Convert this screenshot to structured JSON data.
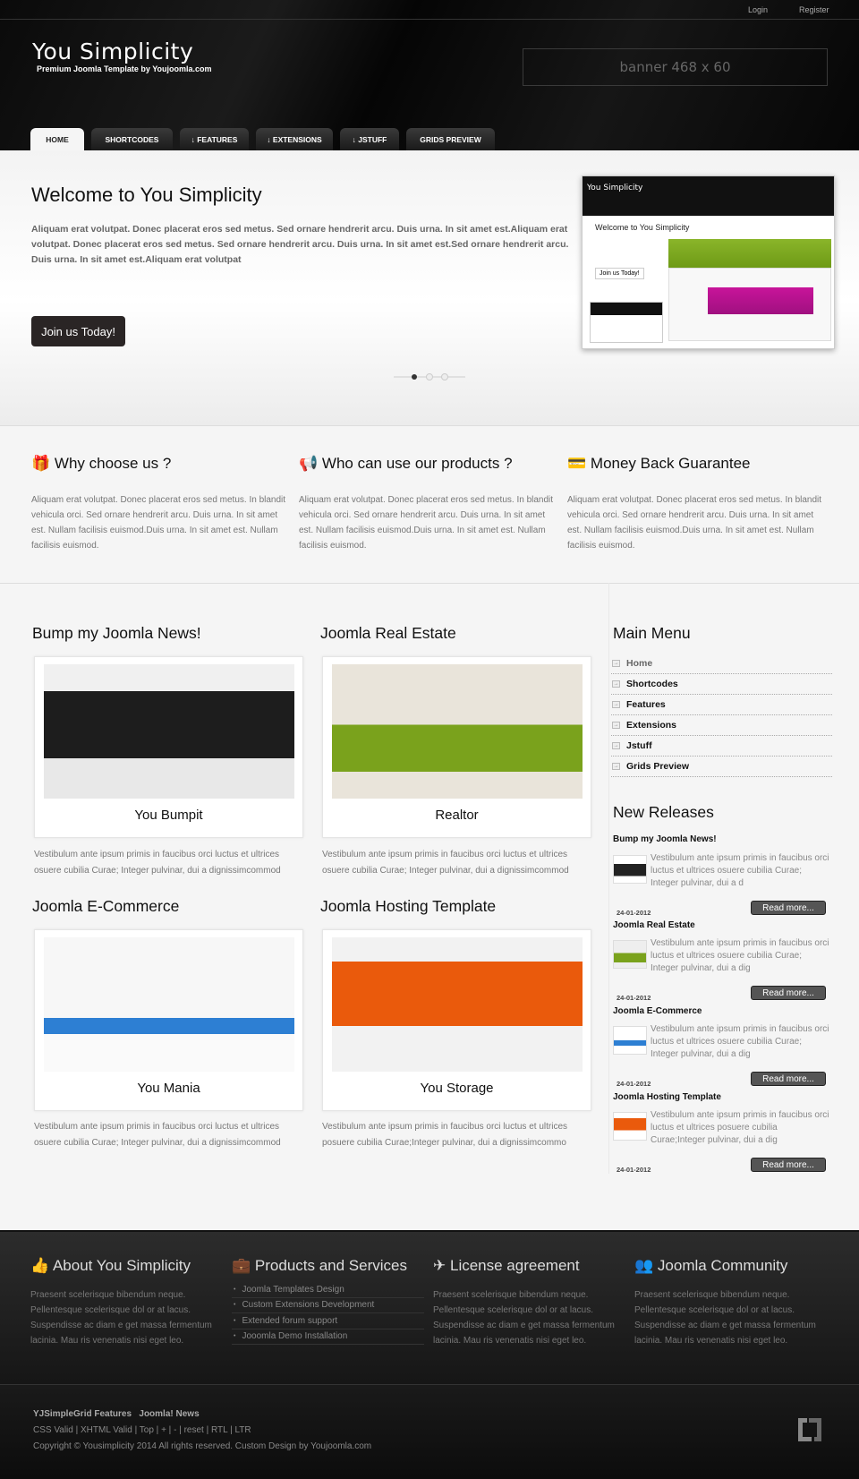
{
  "header": {
    "login": "Login",
    "register": "Register",
    "logo": "You Simplicity",
    "tagline": "Premium Joomla Template by Youjoomla.com",
    "banner": "banner 468 x 60"
  },
  "nav": {
    "tabs": [
      {
        "label": "HOME",
        "active": true
      },
      {
        "label": "SHORTCODES"
      },
      {
        "label": "FEATURES",
        "arrow": true
      },
      {
        "label": "EXTENSIONS",
        "arrow": true
      },
      {
        "label": "JSTUFF",
        "arrow": true
      },
      {
        "label": "GRIDS PREVIEW"
      }
    ]
  },
  "hero": {
    "title": "Welcome to You Simplicity",
    "text": "Aliquam erat volutpat. Donec placerat eros sed metus. Sed ornare hendrerit arcu. Duis urna. In sit amet est.Aliquam erat volutpat. Donec placerat eros sed metus. Sed ornare hendrerit arcu. Duis urna. In sit amet est.Sed ornare hendrerit arcu. Duis urna. In sit amet est.Aliquam erat volutpat",
    "button": "Join us Today!",
    "preview": {
      "logo": "You Simplicity",
      "title": "Welcome to You Simplicity",
      "button": "Join us Today!"
    },
    "slides": 3,
    "active_slide": 1
  },
  "features": [
    {
      "icon": "gift-icon",
      "title": "Why choose us ?",
      "text": "Aliquam erat volutpat. Donec placerat eros sed metus. In blandit vehicula orci. Sed ornare hendrerit arcu. Duis urna. In sit amet est. Nullam facilisis euismod.Duis urna. In sit amet est. Nullam facilisis euismod."
    },
    {
      "icon": "bullhorn-icon",
      "title": "Who can use our products ?",
      "text": "Aliquam erat volutpat. Donec placerat eros sed metus. In blandit vehicula orci. Sed ornare hendrerit arcu. Duis urna. In sit amet est. Nullam facilisis euismod.Duis urna. In sit amet est. Nullam facilisis euismod."
    },
    {
      "icon": "credit-card-icon",
      "title": "Money Back Guarantee",
      "text": "Aliquam erat volutpat. Donec placerat eros sed metus. In blandit vehicula orci. Sed ornare hendrerit arcu. Duis urna. In sit amet est. Nullam facilisis euismod.Duis urna. In sit amet est. Nullam facilisis euismod."
    }
  ],
  "products": [
    {
      "heading": "Bump my Joomla News!",
      "caption": "You Bumpit",
      "text": "Vestibulum ante ipsum primis in faucibus orci luctus et ultrices osuere cubilia Curae; Integer pulvinar, dui a dignissimcommod",
      "color": "#1d1d1d"
    },
    {
      "heading": "Joomla Real Estate",
      "caption": "Realtor",
      "text": "Vestibulum ante ipsum primis in faucibus orci luctus et ultrices osuere cubilia Curae; Integer pulvinar, dui a dignissimcommod",
      "color": "#7aa21c"
    },
    {
      "heading": "Joomla E-Commerce",
      "caption": "You Mania",
      "text": "Vestibulum ante ipsum primis in faucibus orci luctus et ultrices osuere cubilia Curae; Integer pulvinar, dui a dignissimcommod",
      "color": "#2d7fd3"
    },
    {
      "heading": "Joomla Hosting Template",
      "caption": "You Storage",
      "text": "Vestibulum ante ipsum primis in faucibus orci luctus et ultrices posuere cubilia Curae;Integer pulvinar, dui a dignissimcommo",
      "color": "#ea5a0c"
    }
  ],
  "sidebar": {
    "menu_title": "Main Menu",
    "menu": [
      "Home",
      "Shortcodes",
      "Features",
      "Extensions",
      "Jstuff",
      "Grids Preview"
    ],
    "releases_title": "New Releases",
    "releases": [
      {
        "title": "Bump my Joomla News!",
        "text": "Vestibulum ante ipsum primis in faucibus orci luctus et ultrices osuere cubilia Curae; Integer pulvinar, dui a d",
        "date": "24-01-2012",
        "button": "Read more..."
      },
      {
        "title": "Joomla Real Estate",
        "text": "Vestibulum ante ipsum primis in faucibus orci luctus et ultrices osuere cubilia Curae; Integer pulvinar, dui a dig",
        "date": "24-01-2012",
        "button": "Read more..."
      },
      {
        "title": "Joomla E-Commerce",
        "text": "Vestibulum ante ipsum primis in faucibus orci luctus et ultrices osuere cubilia Curae; Integer pulvinar, dui a dig",
        "date": "24-01-2012",
        "button": "Read more..."
      },
      {
        "title": "Joomla Hosting Template",
        "text": "Vestibulum ante ipsum primis in faucibus orci luctus et ultrices posuere cubilia Curae;Integer pulvinar, dui a dig",
        "date": "24-01-2012",
        "button": "Read more..."
      }
    ]
  },
  "footer": {
    "about": {
      "title": "About You Simplicity",
      "text": "Praesent scelerisque bibendum neque. Pellentesque scelerisque dol or at lacus. Suspendisse ac diam e get massa fermentum lacinia. Mau ris venenatis nisi eget leo."
    },
    "products": {
      "title": "Products and Services",
      "items": [
        "Joomla Templates Design",
        "Custom Extensions Development",
        "Extended forum support",
        "Jooomla Demo Installation"
      ]
    },
    "license": {
      "title": "License agreement",
      "text": "Praesent scelerisque bibendum neque. Pellentesque scelerisque dol or at lacus. Suspendisse ac diam e get massa fermentum lacinia. Mau ris venenatis nisi eget leo."
    },
    "community": {
      "title": "Joomla Community",
      "text": "Praesent scelerisque bibendum neque. Pellentesque scelerisque dol or at lacus. Suspendisse ac diam e get massa fermentum lacinia. Mau ris venenatis nisi eget leo."
    }
  },
  "bottom": {
    "links": [
      "YJSimpleGrid Features",
      "Joomla! News"
    ],
    "valid": [
      "CSS Valid",
      "XHTML Valid",
      "Top",
      "+",
      "-",
      "reset",
      "RTL",
      "LTR"
    ],
    "copyright": "Copyright © Yousimplicity 2014 All rights reserved. Custom Design by Youjoomla.com"
  }
}
